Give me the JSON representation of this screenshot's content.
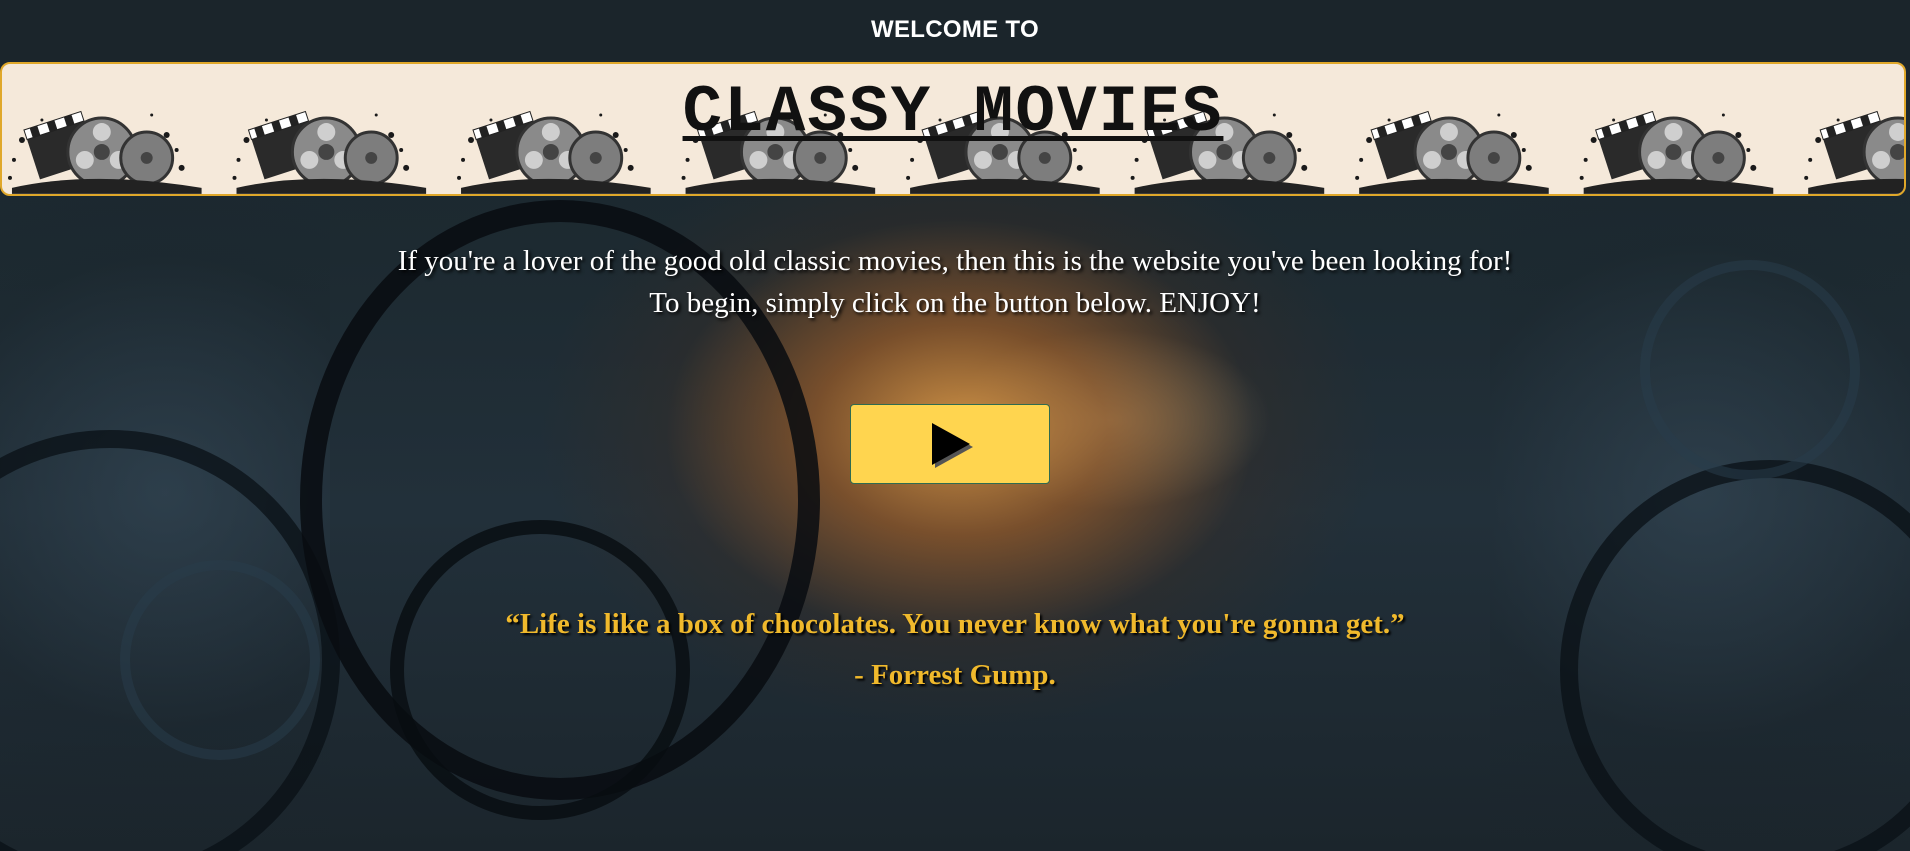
{
  "header": {
    "welcome": "WELCOME TO",
    "title": "CLASSY MOVIES"
  },
  "intro": {
    "line1": "If you're a lover of the good old classic movies, then this is the website you've been looking for!",
    "line2": "To begin, simply click on the button below. ENJOY!"
  },
  "play_button": {
    "icon": "play-icon"
  },
  "quote": {
    "text": "“Life is like a box of chocolates. You never know what you're gonna get.”",
    "author": "- Forrest Gump."
  },
  "colors": {
    "accent": "#ffd54f",
    "quote": "#f0b92c",
    "banner_border": "#e0a82a",
    "header_bg": "#1b252b"
  }
}
